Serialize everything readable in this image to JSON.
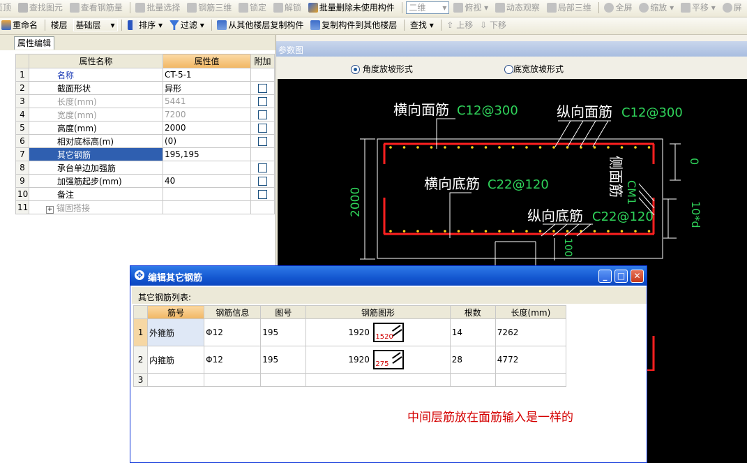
{
  "toolbar1": {
    "items": [
      "页顶",
      "查找图元",
      "查看钢筋量",
      "批量选择",
      "钢筋三维",
      "锁定",
      "解锁",
      "批量删除未使用构件",
      "二维",
      "俯视",
      "动态观察",
      "局部三维",
      "全屏",
      "缩放",
      "平移",
      "屏"
    ]
  },
  "toolbar2": {
    "rename": "重命名",
    "floor_label": "楼层",
    "floor_value": "基础层",
    "sort": "排序",
    "filter": "过滤",
    "copy_from": "从其他楼层复制构件",
    "copy_to": "复制构件到其他楼层",
    "find": "查找",
    "move_up": "上移",
    "move_down": "下移"
  },
  "property_panel": {
    "tab": "属性编辑",
    "headers": {
      "name": "属性名称",
      "value": "属性值",
      "extra": "附加"
    },
    "rows": [
      {
        "no": "1",
        "name": "名称",
        "value": "CT-5-1",
        "check": false
      },
      {
        "no": "2",
        "name": "截面形状",
        "value": "异形",
        "check": true
      },
      {
        "no": "3",
        "name": "长度(mm)",
        "value": "5441",
        "check": true
      },
      {
        "no": "4",
        "name": "宽度(mm)",
        "value": "7200",
        "check": true
      },
      {
        "no": "5",
        "name": "高度(mm)",
        "value": "2000",
        "check": true
      },
      {
        "no": "6",
        "name": "相对底标高(m)",
        "value": "(0)",
        "check": true
      },
      {
        "no": "7",
        "name": "其它钢筋",
        "value": "195,195",
        "check": false
      },
      {
        "no": "8",
        "name": "承台单边加强筋",
        "value": "",
        "check": true
      },
      {
        "no": "9",
        "name": "加强筋起步(mm)",
        "value": "40",
        "check": true
      },
      {
        "no": "10",
        "name": "备注",
        "value": "",
        "check": true
      },
      {
        "no": "11",
        "name": "锚固搭接",
        "value": "",
        "check": false
      }
    ]
  },
  "param_window": {
    "title": "参数图",
    "radio_angle": "角度放坡形式",
    "radio_width": "底宽放坡形式",
    "drawing": {
      "top_transverse": "横向面筋",
      "top_transverse_spec": "C12@300",
      "top_longitudinal": "纵向面筋",
      "top_longitudinal_spec": "C12@300",
      "bottom_transverse": "横向底筋",
      "bottom_transverse_spec": "C22@120",
      "bottom_longitudinal": "纵向底筋",
      "bottom_longitudinal_spec": "C22@120",
      "side_bar": "侧面筋",
      "side_bar_spec": "CM1",
      "height_dim": "2000",
      "top_dim": "0",
      "bottom_dim": "10*d",
      "step_dim": "100"
    }
  },
  "dialog": {
    "title": "编辑其它钢筋",
    "list_label": "其它钢筋列表:",
    "headers": [
      "筋号",
      "钢筋信息",
      "图号",
      "钢筋图形",
      "根数",
      "长度(mm)"
    ],
    "rows": [
      {
        "no": "1",
        "name": "外箍筋",
        "info": "Φ12",
        "fig": "195",
        "dim": "1920",
        "shape_val": "1520",
        "count": "14",
        "length": "7262"
      },
      {
        "no": "2",
        "name": "内箍筋",
        "info": "Φ12",
        "fig": "195",
        "dim": "1920",
        "shape_val": "275",
        "count": "28",
        "length": "4772"
      },
      {
        "no": "3",
        "name": "",
        "info": "",
        "fig": "",
        "dim": "",
        "shape_val": "",
        "count": "",
        "length": ""
      }
    ],
    "note": "中间层筋放在面筋输入是一样的"
  },
  "colors": {
    "accent_blue": "#0c47c0",
    "header_orange": "#f6c27a",
    "selected_row": "#2f5fb0",
    "drawing_white": "#ffffff",
    "drawing_green": "#2fd35a",
    "drawing_red": "#ff2020",
    "note_red": "#d40000"
  }
}
